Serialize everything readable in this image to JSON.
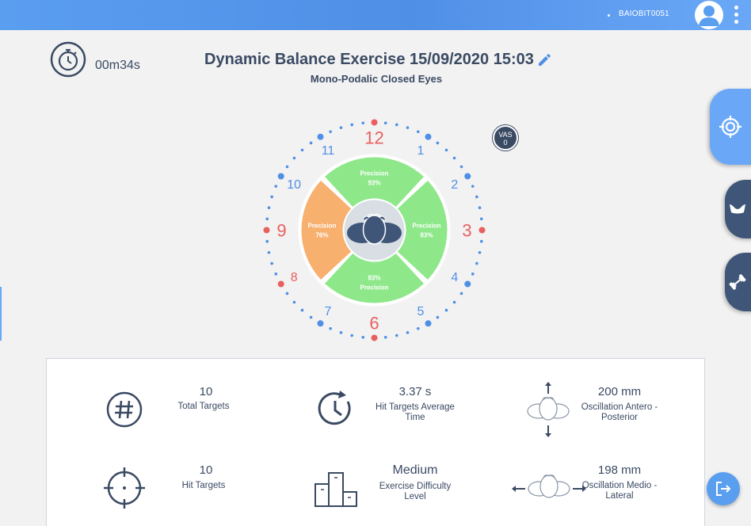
{
  "header": {
    "user_id": "BAIOBIT0051",
    "brand_color": "#5a9ef0",
    "avatar_icon": "user-avatar-icon",
    "menu_icon": "kebab-menu-icon"
  },
  "session": {
    "elapsed_time": "00m34s",
    "title": "Dynamic Balance Exercise 15/09/2020 15:03",
    "subtitle": "Mono-Podalic Closed Eyes"
  },
  "clock": {
    "numbers": [
      "12",
      "1",
      "2",
      "3",
      "4",
      "5",
      "6",
      "7",
      "8",
      "9",
      "10",
      "11"
    ],
    "red_numbers": [
      "12",
      "3",
      "6",
      "9"
    ],
    "segments": {
      "top": {
        "label": "Precision",
        "value": "93%",
        "color": "#8ee88a"
      },
      "right": {
        "label": "Precision",
        "value": "83%",
        "color": "#8ee88a"
      },
      "bottom": {
        "label": "Precision",
        "value": "83%",
        "color": "#8ee88a"
      },
      "left": {
        "label": "Precision",
        "value": "76%",
        "color": "#f8b06f"
      }
    }
  },
  "vas": {
    "label": "VAS",
    "value": "0"
  },
  "stats": [
    {
      "value": "10",
      "label": "Total Targets",
      "icon": "hash-icon"
    },
    {
      "value": "3.37 s",
      "label": "Hit Targets Average Time",
      "icon": "timer-reset-icon"
    },
    {
      "value": "200 mm",
      "label": "Oscillation Antero - Posterior",
      "icon": "antero-posterior-icon"
    },
    {
      "value": "10",
      "label": "Hit Targets",
      "icon": "crosshair-icon"
    },
    {
      "value": "Medium",
      "label": "Exercise Difficulty Level",
      "icon": "podium-icon"
    },
    {
      "value": "198 mm",
      "label": "Oscillation Medio - Lateral",
      "icon": "medio-lateral-icon"
    }
  ],
  "side_nav": [
    {
      "icon": "target-icon"
    },
    {
      "icon": "insole-icon"
    },
    {
      "icon": "dumbbell-icon"
    }
  ],
  "exit_icon": "exit-icon"
}
